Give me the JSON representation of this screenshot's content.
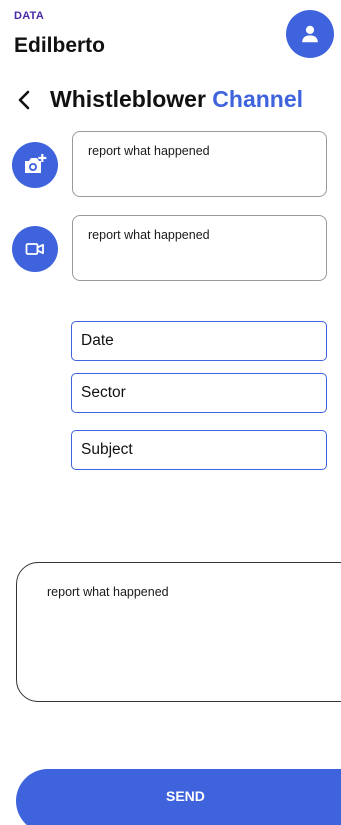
{
  "header": {
    "brand": "DATA",
    "username": "Edilberto",
    "avatar_icon": "user-icon"
  },
  "nav": {
    "back_icon": "chevron-left-icon",
    "title_main": "Whistleblower",
    "title_accent": "Channel"
  },
  "attachments": [
    {
      "icon": "camera-add-icon",
      "placeholder": "report what happened"
    },
    {
      "icon": "video-icon",
      "placeholder": "report what happened"
    }
  ],
  "fields": {
    "date": "Date",
    "sector": "Sector",
    "subject": "Subject"
  },
  "report": {
    "placeholder": "report what happened"
  },
  "actions": {
    "send_label": "SEND"
  },
  "colors": {
    "accent": "#3f63dc",
    "brand": "#4b2aa6",
    "text": "#111111",
    "border": "#9a9a9a"
  }
}
